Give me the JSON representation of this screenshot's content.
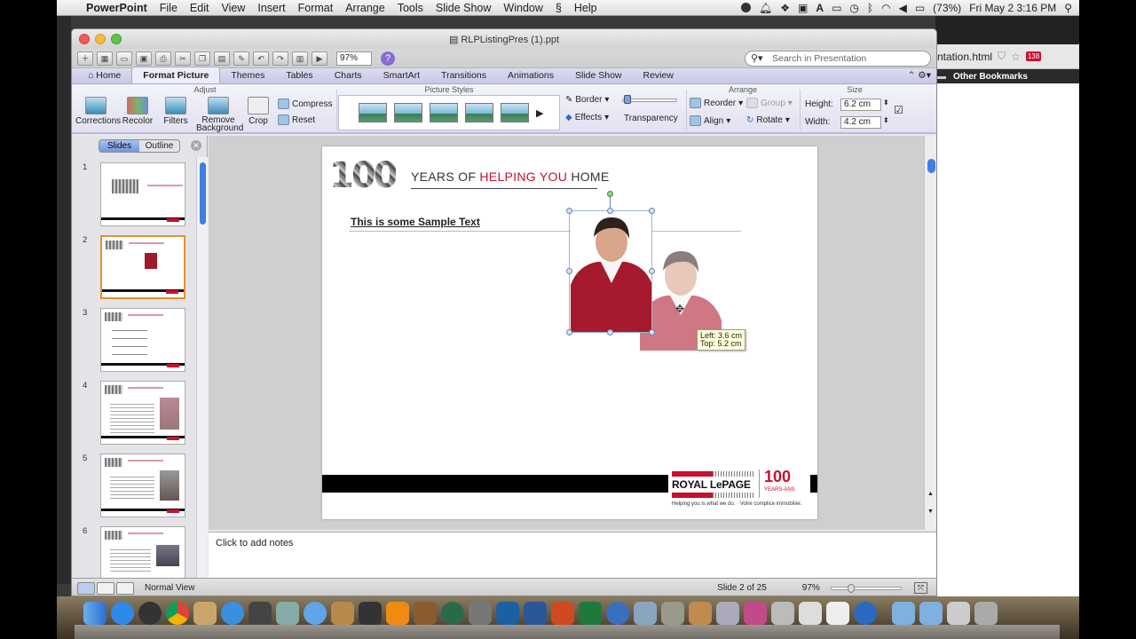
{
  "menubar": {
    "app": "PowerPoint",
    "items": [
      "File",
      "Edit",
      "View",
      "Insert",
      "Format",
      "Arrange",
      "Tools",
      "Slide Show",
      "Window",
      "Help"
    ],
    "battery": "(73%)",
    "clock": "Fri May 2  3:16 PM"
  },
  "browser": {
    "url_fragment": "ntation.html",
    "badge": "138",
    "bookmarks": "Other Bookmarks"
  },
  "window": {
    "title": "RLPListingPres (1).ppt",
    "zoom": "97%",
    "search_placeholder": "Search in Presentation"
  },
  "ribbon": {
    "tabs": [
      "Home",
      "Format Picture",
      "Themes",
      "Tables",
      "Charts",
      "SmartArt",
      "Transitions",
      "Animations",
      "Slide Show",
      "Review"
    ],
    "active_tab": "Format Picture",
    "groups": {
      "adjust": "Adjust",
      "picture_styles": "Picture Styles",
      "arrange": "Arrange",
      "size": "Size"
    },
    "adjust": {
      "corrections": "Corrections",
      "recolor": "Recolor",
      "filters": "Filters",
      "remove_bg": "Remove Background",
      "crop": "Crop",
      "compress": "Compress",
      "reset": "Reset"
    },
    "styles": {
      "border": "Border",
      "effects": "Effects",
      "transparency": "Transparency"
    },
    "arrange": {
      "reorder": "Reorder",
      "group": "Group",
      "align": "Align",
      "rotate": "Rotate"
    },
    "size": {
      "height_label": "Height:",
      "height": "6.2 cm",
      "width_label": "Width:",
      "width": "4.2 cm"
    }
  },
  "leftpane": {
    "slides_tab": "Slides",
    "outline_tab": "Outline",
    "numbers": [
      "1",
      "2",
      "3",
      "4",
      "5",
      "6"
    ]
  },
  "slide": {
    "logo_text": "100",
    "heading_pre": "YEARS OF ",
    "heading_red": "HELPING YOU",
    "heading_post": " HOME",
    "sample_text": "This is some Sample Text",
    "tooltip_left": "Left: 3.6 cm",
    "tooltip_top": "Top: 5.2 cm",
    "brand": "ROYAL LePAGE",
    "brand_100": "100",
    "brand_years": "YEARS-ANS",
    "tagline": "Helping you is what we do. · Votre complice immobilier."
  },
  "notes_placeholder": "Click to add notes",
  "status": {
    "view": "Normal View",
    "slide_count": "Slide 2 of 25",
    "zoom": "97%"
  },
  "colors": {
    "accent_red": "#c8102e",
    "ribbon_purple": "#b9b6e2",
    "selection_orange": "#e6912c"
  }
}
